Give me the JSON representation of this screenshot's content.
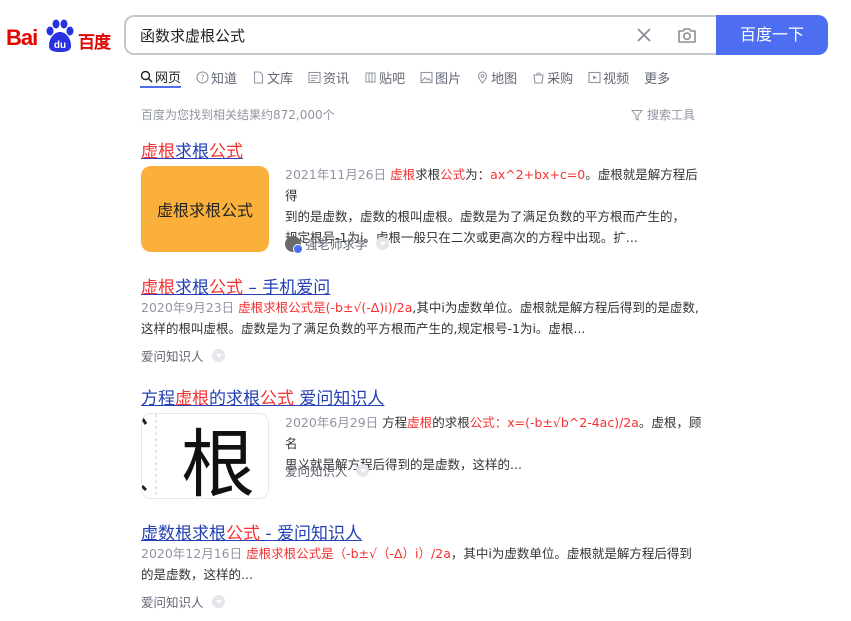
{
  "logo": {
    "text_bai": "Bai",
    "text_du": "百度"
  },
  "search": {
    "query": "函数求虚根公式",
    "button_label": "百度一下"
  },
  "tabs": [
    {
      "label": "网页",
      "icon": "search-icon",
      "active": true
    },
    {
      "label": "知道",
      "icon": "question-icon"
    },
    {
      "label": "文库",
      "icon": "document-icon"
    },
    {
      "label": "资讯",
      "icon": "news-icon"
    },
    {
      "label": "贴吧",
      "icon": "tieba-icon"
    },
    {
      "label": "图片",
      "icon": "image-icon"
    },
    {
      "label": "地图",
      "icon": "map-icon"
    },
    {
      "label": "采购",
      "icon": "purchase-icon"
    },
    {
      "label": "视频",
      "icon": "video-icon"
    },
    {
      "label": "更多"
    }
  ],
  "results_info": {
    "count_text": "百度为您找到相关结果约872,000个",
    "tools_label": "搜索工具"
  },
  "results": [
    {
      "title_parts": [
        "虚根",
        "求根",
        "公式"
      ],
      "date": "2021年11月26日",
      "snippet_lines": [
        [
          "虚根",
          "求根",
          "公式",
          "为：",
          "ax^2+bx+c=0",
          "。虚根就是解方程后得"
        ],
        [
          "到的是虚数，虚数的根叫虚根。虚数是为了满足负数的平方根而产生的，"
        ],
        [
          "规定根号-1为i。虚根一般只在二次或更高次的方程中出现。扩..."
        ]
      ],
      "thumb_text": "虚根求根公式",
      "source": "强老师求学"
    },
    {
      "title_parts": [
        "虚根",
        "求根",
        "公式",
        " – 手机爱问"
      ],
      "date": "2020年9月23日",
      "snippet_lines": [
        [
          "虚根求根公式是(-b±√(-Δ)i)/2a",
          ",其中i为虚数单位。虚根就是解方程后得到的是虚数,"
        ],
        [
          "这样的根叫虚根。虚数是为了满足负数的平方根而产生的,规定根号-1为i。虚根..."
        ]
      ],
      "source": "爱问知识人"
    },
    {
      "title_parts": [
        "方程",
        "虚根",
        "的求根",
        "公式",
        " 爱问知识人"
      ],
      "date": "2020年6月29日",
      "snippet_lines": [
        [
          "方程",
          "虚根",
          "的求根",
          "公式：",
          "x=(-b±√b^2-4ac)/2a",
          "。虚根，顾名"
        ],
        [
          "思义就是解方程后得到的是虚数，这样的..."
        ]
      ],
      "thumb_char": "根",
      "source": "爱问知识人"
    },
    {
      "title_parts": [
        "虚数根求根",
        "公式",
        " - 爱问知识人"
      ],
      "date": "2020年12月16日",
      "snippet_lines": [
        [
          "虚根求根公式是（-b±√（-Δ）i）/2a",
          "，其中i为虚数单位。虚根就是解方程后得到"
        ],
        [
          "的是虚数，这样的..."
        ]
      ],
      "source": "爱问知识人"
    }
  ],
  "colors": {
    "accent": "#4e6ef2",
    "highlight": "#f73131",
    "link": "#2440b3",
    "thumb_orange": "#fbb03b"
  }
}
